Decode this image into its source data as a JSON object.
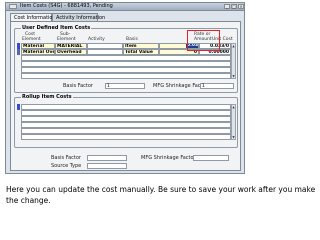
{
  "window": {
    "title": "Item Costs (S4G) - 6881493, Pending"
  },
  "tabs": [
    {
      "label": "Cost Information"
    },
    {
      "label": "Activity Information"
    }
  ],
  "user_defined": {
    "title": "User Defined Item Costs",
    "headers": {
      "cost_element": [
        "Cost",
        "Element"
      ],
      "sub_element": [
        "Sub-",
        "Element"
      ],
      "activity": "Activity",
      "basis": "Basis",
      "rate_amount": [
        "Rate or",
        "Amount"
      ],
      "unit_cost": "Unit Cost"
    },
    "rows": [
      {
        "cost_element": "Material",
        "sub_element": "MATERIAL",
        "activity": "",
        "basis": "Item",
        "rate_amount": "0.03",
        "unit_cost": "0.033/0"
      },
      {
        "cost_element": "Material Overh",
        "sub_element": "Overhead",
        "activity": "",
        "basis": "Total Value",
        "rate_amount": "0",
        "unit_cost": "0.00000"
      }
    ]
  },
  "basis_factor": {
    "label": "Basis Factor",
    "value": "1"
  },
  "mfg_shrinkage": {
    "label": "MFG Shrinkage Factor",
    "value": "1"
  },
  "rollup": {
    "title": "Rollup Item Costs",
    "basis_factor_label": "Basis Factor",
    "mfg_shrinkage_label": "MFG Shrinkage Factor",
    "source_type_label": "Source Type"
  },
  "caption": "Here you can update the cost manually.  Be sure to save your work after you make the change."
}
